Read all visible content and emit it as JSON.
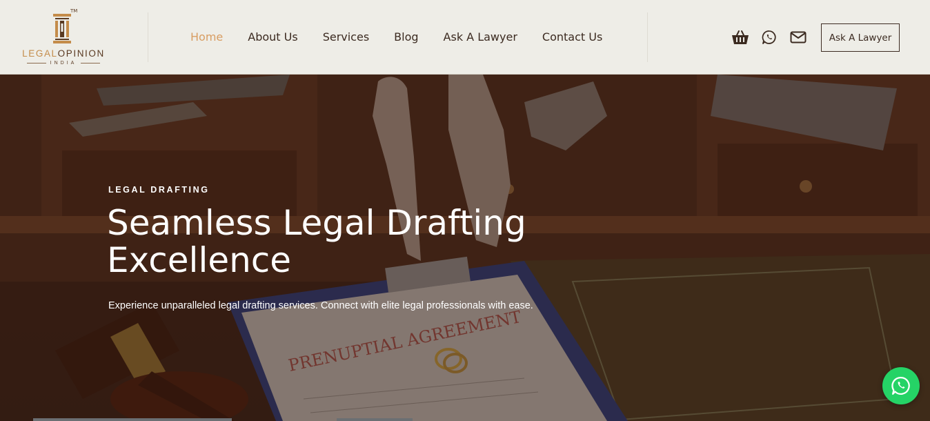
{
  "brand": {
    "name_part1": "LEGAL",
    "name_part2": "OPINION",
    "sub": "INDIA",
    "tm": "TM"
  },
  "nav": {
    "items": [
      {
        "label": "Home",
        "active": true
      },
      {
        "label": "About Us",
        "active": false
      },
      {
        "label": "Services",
        "active": false
      },
      {
        "label": "Blog",
        "active": false
      },
      {
        "label": "Ask A Lawyer",
        "active": false
      },
      {
        "label": "Contact Us",
        "active": false
      }
    ]
  },
  "header_icons": [
    "basket-icon",
    "whatsapp-icon",
    "email-icon"
  ],
  "cta": {
    "label": "Ask A Lawyer"
  },
  "hero": {
    "eyebrow": "LEGAL DRAFTING",
    "headline_line1": "Seamless Legal Drafting",
    "headline_line2": "Excellence",
    "subtext": "Experience unparalleled legal drafting services. Connect with elite legal professionals with ease.",
    "image_labels": {
      "document": "PRENUPTIAL AGREEMENT"
    }
  },
  "colors": {
    "header_bg": "#eeede7",
    "accent": "#d89d62",
    "text_dark": "#3b2a20",
    "whatsapp": "#25d366"
  }
}
